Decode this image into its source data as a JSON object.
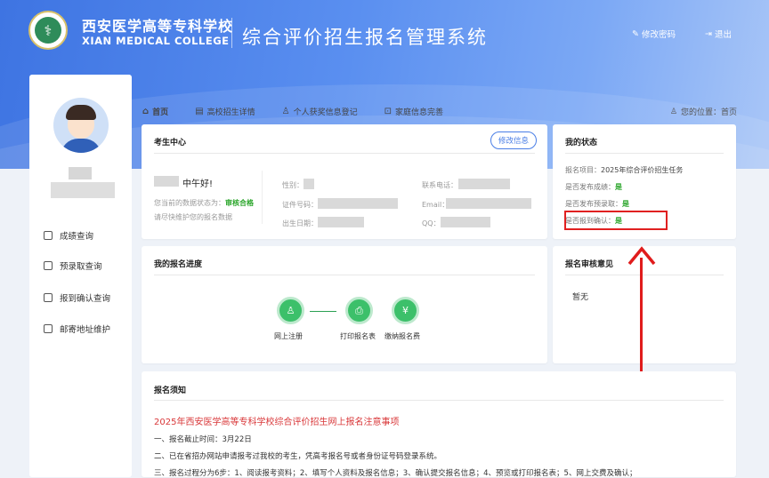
{
  "header": {
    "school_cn": "西安医学高等专科学校",
    "school_en": "XIAN MEDICAL COLLEGE",
    "system_title": "综合评价招生报名管理系统",
    "change_password": "修改密码",
    "logout": "退出"
  },
  "sidebar": {
    "items": [
      {
        "label": "成绩查询"
      },
      {
        "label": "预录取查询"
      },
      {
        "label": "报到确认查询"
      },
      {
        "label": "邮寄地址维护"
      }
    ]
  },
  "nav": {
    "tabs": [
      {
        "label": "首页"
      },
      {
        "label": "高校招生详情"
      },
      {
        "label": "个人获奖信息登记"
      },
      {
        "label": "家庭信息完善"
      }
    ],
    "location_label": "您的位置：首页"
  },
  "student_center": {
    "title": "考生中心",
    "edit_button": "修改信息",
    "greeting": "中午好!",
    "data_status_label": "您当前的数据状态为：",
    "data_status_value": "审核合格",
    "maintain_hint": "请尽快维护您的报名数据",
    "gender_label": "性别：",
    "id_label": "证件号码：",
    "birth_label": "出生日期：",
    "phone_label": "联系电话：",
    "email_label": "Email：",
    "qq_label": "QQ："
  },
  "my_status": {
    "title": "我的状态",
    "project_label": "报名项目：",
    "project_value": "2025年综合评价招生任务",
    "score_label": "是否发布成绩：",
    "score_value": "是",
    "admit_label": "是否发布预录取：",
    "admit_value": "是",
    "confirm_label": "是否报到确认：",
    "confirm_value": "是"
  },
  "progress": {
    "title": "我的报名进度",
    "steps": [
      {
        "label": "网上注册"
      },
      {
        "label": "打印报名表"
      },
      {
        "label": "缴纳报名费"
      }
    ]
  },
  "review": {
    "title": "报名审核意见",
    "content": "暂无"
  },
  "notice": {
    "title": "报名须知",
    "headline": "2025年西安医学高等专科学校综合评价招生网上报名注意事项",
    "lines": [
      "一、报名截止时间：3月22日",
      "二、已在省招办网站申请报考过我校的考生，凭高考报名号或者身份证号码登录系统。",
      "三、报名过程分为6步：1、阅读报考资料；2、填写个人资料及报名信息；3、确认提交报名信息；4、预览或打印报名表；5、网上交费及确认；"
    ]
  },
  "colors": {
    "banner": "#4a80e8",
    "accent": "#4a7ee6",
    "success": "#2aa52a",
    "highlight": "#e02020"
  }
}
